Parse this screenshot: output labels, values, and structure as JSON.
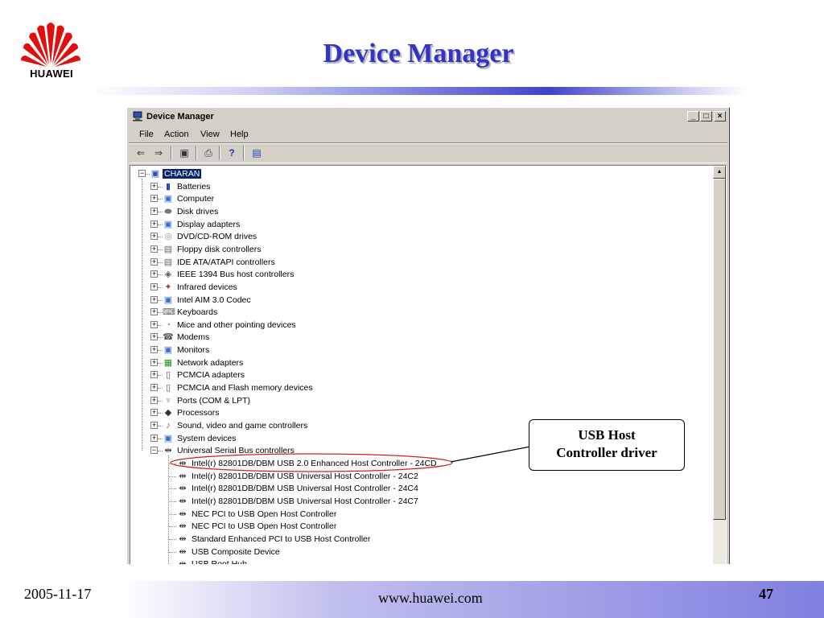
{
  "slide": {
    "title": "Device Manager",
    "logo_text": "HUAWEI",
    "footer": {
      "date": "2005-11-17",
      "url": "www.huawei.com",
      "page": "47"
    }
  },
  "window": {
    "title": "Device Manager",
    "buttons": {
      "minimize": "_",
      "maximize": "□",
      "close": "×"
    },
    "menu": [
      "File",
      "Action",
      "View",
      "Help"
    ],
    "toolbar": [
      {
        "icon": "back-icon",
        "glyph": "⇐"
      },
      {
        "icon": "forward-icon",
        "glyph": "⇒"
      },
      {
        "icon": "properties-icon",
        "glyph": "▣"
      },
      {
        "icon": "print-icon",
        "glyph": "⎙"
      },
      {
        "icon": "help-icon",
        "glyph": "?"
      },
      {
        "icon": "scan-icon",
        "glyph": "▤"
      }
    ]
  },
  "tree": {
    "root": "CHARAN",
    "categories": [
      {
        "label": "Batteries",
        "icon": "battery-icon"
      },
      {
        "label": "Computer",
        "icon": "computer-icon"
      },
      {
        "label": "Disk drives",
        "icon": "disk-icon"
      },
      {
        "label": "Display adapters",
        "icon": "display-icon"
      },
      {
        "label": "DVD/CD-ROM drives",
        "icon": "dvd-icon"
      },
      {
        "label": "Floppy disk controllers",
        "icon": "floppy-icon"
      },
      {
        "label": "IDE ATA/ATAPI controllers",
        "icon": "ide-icon"
      },
      {
        "label": "IEEE 1394 Bus host controllers",
        "icon": "ieee-icon"
      },
      {
        "label": "Infrared devices",
        "icon": "infrared-icon"
      },
      {
        "label": "Intel AIM 3.0 Codec",
        "icon": "codec-icon"
      },
      {
        "label": "Keyboards",
        "icon": "keyboard-icon"
      },
      {
        "label": "Mice and other pointing devices",
        "icon": "mouse-icon"
      },
      {
        "label": "Modems",
        "icon": "modem-icon"
      },
      {
        "label": "Monitors",
        "icon": "monitor-icon"
      },
      {
        "label": "Network adapters",
        "icon": "network-icon"
      },
      {
        "label": "PCMCIA adapters",
        "icon": "pcmcia-icon"
      },
      {
        "label": "PCMCIA and Flash memory devices",
        "icon": "flash-icon"
      },
      {
        "label": "Ports (COM & LPT)",
        "icon": "port-icon"
      },
      {
        "label": "Processors",
        "icon": "processor-icon"
      },
      {
        "label": "Sound, video and game controllers",
        "icon": "sound-icon"
      },
      {
        "label": "System devices",
        "icon": "system-icon"
      },
      {
        "label": "Universal Serial Bus controllers",
        "icon": "usb-icon"
      }
    ],
    "usb_children": [
      "Intel(r) 82801DB/DBM USB 2.0 Enhanced Host Controller - 24CD",
      "Intel(r) 82801DB/DBM USB Universal Host Controller - 24C2",
      "Intel(r) 82801DB/DBM USB Universal Host Controller - 24C4",
      "Intel(r) 82801DB/DBM USB Universal Host Controller - 24C7",
      "NEC PCI to USB Open Host Controller",
      "NEC PCI to USB Open Host Controller",
      "Standard Enhanced PCI to USB Host Controller",
      "USB Composite Device",
      "USB Root Hub"
    ],
    "expander_collapsed": "+",
    "expander_expanded": "−"
  },
  "callout": {
    "line1": "USB Host",
    "line2": "Controller driver"
  },
  "colors": {
    "title": "#3333cc",
    "selection": "#0a246a",
    "highlight_ellipse": "#d02020"
  }
}
